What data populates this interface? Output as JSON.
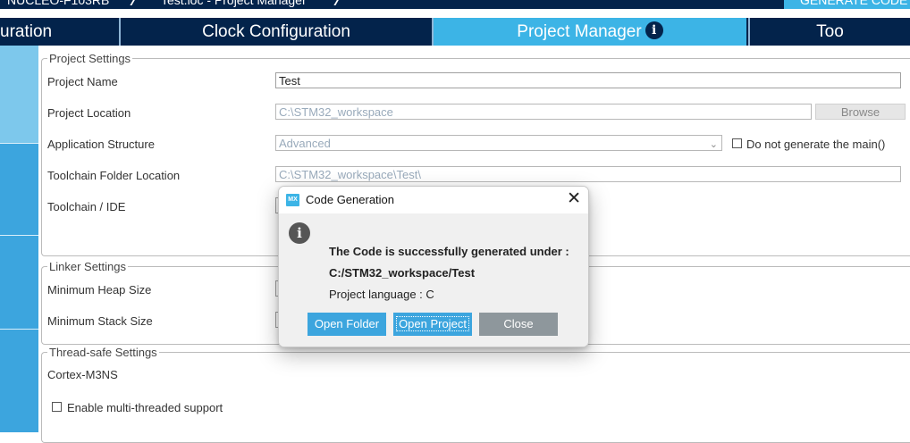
{
  "colors": {
    "navy": "#03234b",
    "accent": "#3cb4e6",
    "rail": "#3ca5de",
    "grey_button": "#8e979c"
  },
  "breadcrumb": [
    "NUCLEO-F103RB",
    "Test.ioc - Project Manager"
  ],
  "generate_button_label": "GENERATE CODE",
  "tabs": [
    {
      "label": "Pinout & Configuration",
      "visible": "uration"
    },
    {
      "label": "Clock Configuration"
    },
    {
      "label": "Project Manager",
      "icon": "info-icon"
    },
    {
      "label": "Tools",
      "visible": "Too"
    }
  ],
  "project_settings": {
    "legend": "Project Settings",
    "project_name_label": "Project Name",
    "project_name_value": "Test",
    "project_location_label": "Project Location",
    "project_location_value": "C:\\STM32_workspace",
    "browse_label": "Browse",
    "app_structure_label": "Application Structure",
    "app_structure_value": "Advanced",
    "do_not_generate_main_label": "Do not generate the main()",
    "toolchain_folder_label": "Toolchain Folder Location",
    "toolchain_folder_value": "C:\\STM32_workspace\\Test\\",
    "toolchain_ide_label": "Toolchain / IDE"
  },
  "linker_settings": {
    "legend": "Linker Settings",
    "min_heap_label": "Minimum Heap Size",
    "min_stack_label": "Minimum Stack Size"
  },
  "thread_safe_settings": {
    "legend": "Thread-safe Settings",
    "core_label": "Cortex-M3NS",
    "enable_multithread_label": "Enable multi-threaded support"
  },
  "dialog": {
    "title": "Code Generation",
    "app_icon_text": "MX",
    "line1": "The Code is successfully generated under :",
    "line2": "C:/STM32_workspace/Test",
    "line3": "Project language : C",
    "buttons": {
      "open_folder": "Open Folder",
      "open_project": "Open Project",
      "close": "Close"
    }
  }
}
